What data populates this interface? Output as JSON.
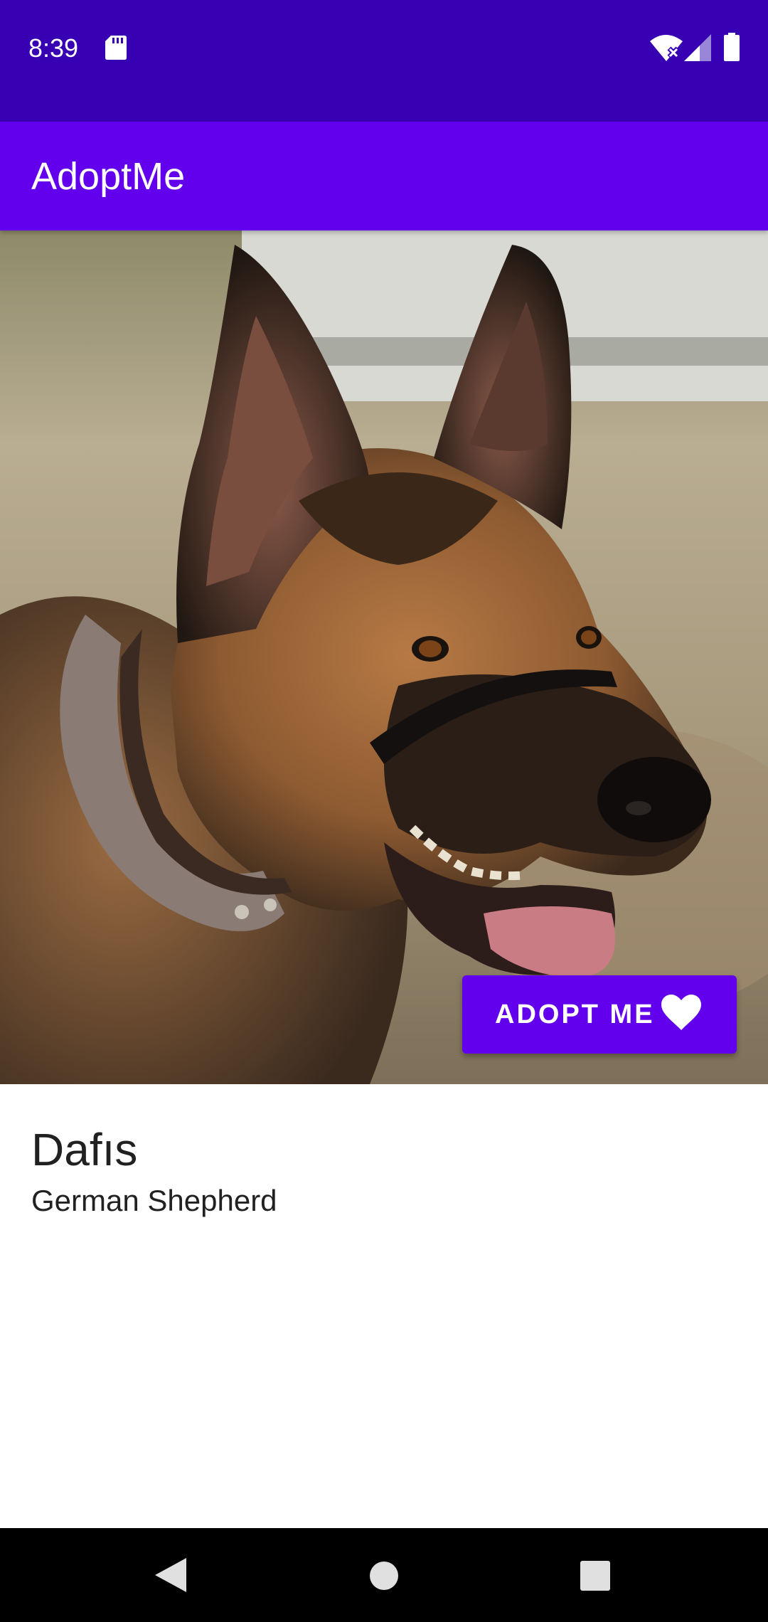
{
  "status_bar": {
    "time": "8:39",
    "icons": [
      "sd-card-icon",
      "wifi-off-icon",
      "signal-icon",
      "battery-icon"
    ]
  },
  "app_bar": {
    "title": "AdoptMe"
  },
  "pet": {
    "photo_subject": "german-shepherd-photo",
    "name": "Dafıs",
    "breed": "German Shepherd"
  },
  "adopt_button": {
    "label": "ADOPT ME",
    "icon": "heart-icon"
  },
  "navigation_bar": {
    "icons": [
      "back-icon",
      "home-icon",
      "recents-icon"
    ]
  },
  "colors": {
    "status_bar": "#3700b3",
    "primary": "#6200ee",
    "text": "#212121",
    "navigation_bar": "#000000"
  }
}
